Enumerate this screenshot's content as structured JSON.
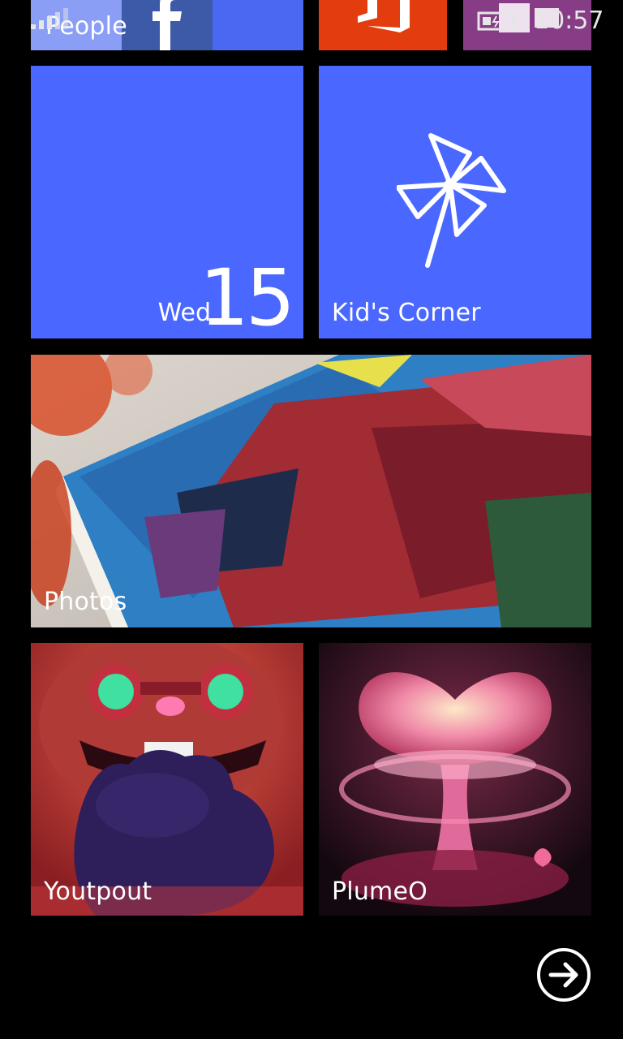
{
  "status_bar": {
    "time": "10:57",
    "signal_icon": "signal-strength-icon",
    "battery_icon": "battery-icon"
  },
  "tiles": {
    "people": {
      "label": "People",
      "color": "#4a68f2",
      "icon": "facebook-icon"
    },
    "office": {
      "color": "#e33c0e",
      "icon": "office-icon"
    },
    "store": {
      "color": "#863d86",
      "icon": "store-icon"
    },
    "calendar": {
      "day": "Wed",
      "date": "15",
      "color": "#4a68ff"
    },
    "kids_corner": {
      "label": "Kid's Corner",
      "color": "#4a68ff",
      "icon": "pinwheel-icon"
    },
    "photos": {
      "label": "Photos"
    },
    "youtpout": {
      "label": "Youtpout"
    },
    "plumeo": {
      "label": "PlumeO"
    }
  },
  "navigation": {
    "next_icon": "arrow-right-circle-icon"
  }
}
